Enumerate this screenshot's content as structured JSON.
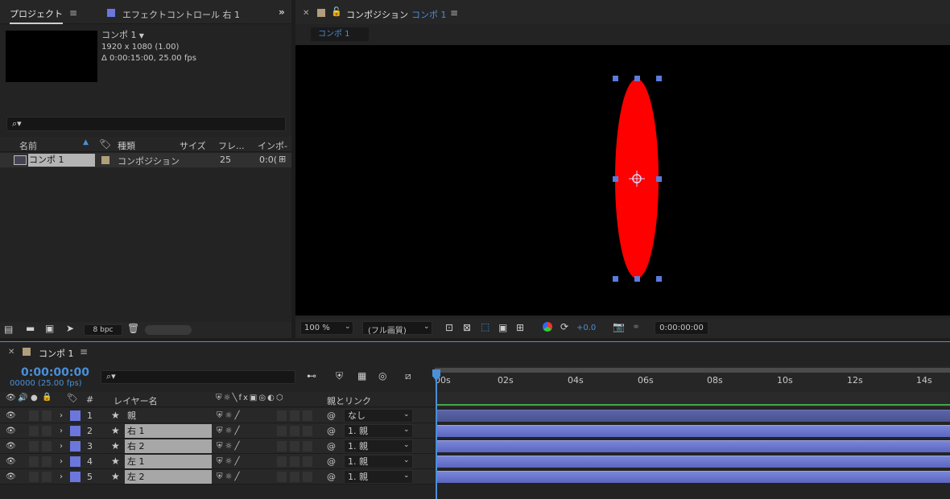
{
  "project_panel": {
    "tab_label": "プロジェクト",
    "effects_tab_label": "エフェクトコントロール 右 1",
    "comp_name": "コンポ 1",
    "comp_resolution": "1920 x 1080 (1.00)",
    "comp_duration": "Δ 0:00:15:00, 25.00 fps",
    "columns": [
      "名前",
      "種類",
      "サイズ",
      "フレ...",
      "インポ-"
    ],
    "item": {
      "name": "コンポ 1",
      "type": "コンポジション",
      "fps": "25",
      "inpoint": "0:0("
    },
    "bpc": "8 bpc"
  },
  "comp_panel": {
    "tab_label": "コンポジション",
    "tab_comp": "コンポ 1",
    "sub_tab": "コンポ 1",
    "zoom": "100 %",
    "quality": "(フル画質)",
    "exposure": "+0.0",
    "timecode": "0:00:00:00"
  },
  "timeline": {
    "tab_label": "コンポ 1",
    "timecode": "0:00:00:00",
    "frame_info": "00000 (25.00 fps)",
    "col_layer_name": "レイヤー名",
    "col_parent": "親とリンク",
    "col_num": "#",
    "ruler": [
      "00s",
      "02s",
      "04s",
      "06s",
      "08s",
      "10s",
      "12s",
      "14s"
    ],
    "layers": [
      {
        "num": "1",
        "name": "親",
        "parent": "なし"
      },
      {
        "num": "2",
        "name": "右 1",
        "parent": "1. 親"
      },
      {
        "num": "3",
        "name": "右 2",
        "parent": "1. 親"
      },
      {
        "num": "4",
        "name": "左 1",
        "parent": "1. 親"
      },
      {
        "num": "5",
        "name": "左 2",
        "parent": "1. 親"
      }
    ]
  },
  "colors": {
    "accent": "#4a8fd8",
    "layer_label": "#6b77dc",
    "shape": "#ff0000",
    "handle": "#5b7bdd"
  }
}
